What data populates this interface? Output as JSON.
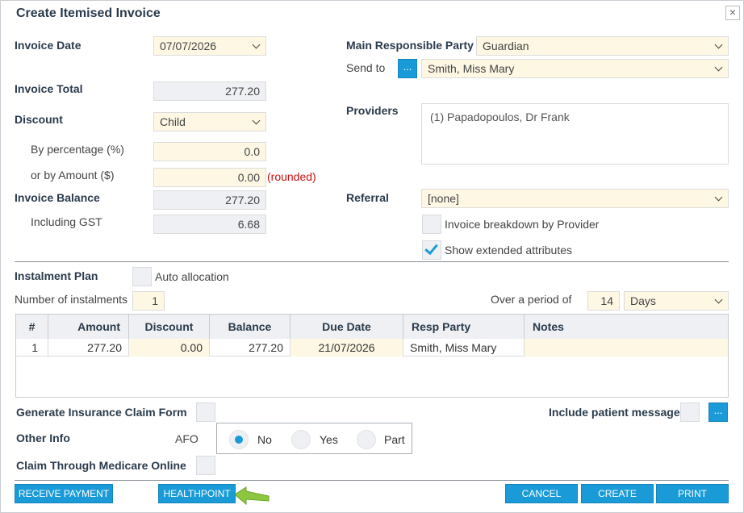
{
  "dialog": {
    "title": "Create Itemised Invoice",
    "close_glyph": "×"
  },
  "left": {
    "invoice_date_label": "Invoice Date",
    "invoice_date_value": "07/07/2026",
    "invoice_total_label": "Invoice Total",
    "invoice_total_value": "277.20",
    "discount_label": "Discount",
    "discount_value": "Child",
    "by_percentage_label": "By percentage (%)",
    "by_percentage_value": "0.0",
    "by_amount_label": "or by Amount ($)",
    "by_amount_value": "0.00",
    "rounded_note": "(rounded)",
    "invoice_balance_label": "Invoice Balance",
    "invoice_balance_value": "277.20",
    "gst_label": "Including GST",
    "gst_value": "6.68"
  },
  "right": {
    "main_party_label": "Main Responsible Party",
    "main_party_value": "Guardian",
    "send_to_label": "Send to",
    "send_to_button": "...",
    "send_to_value": "Smith, Miss Mary",
    "providers_label": "Providers",
    "providers_value": "(1) Papadopoulos, Dr Frank",
    "referral_label": "Referral",
    "referral_value": "[none]",
    "breakdown_label": "Invoice breakdown by Provider",
    "breakdown_checked": false,
    "extended_label": "Show extended attributes",
    "extended_checked": true
  },
  "instalment": {
    "plan_label": "Instalment Plan",
    "auto_allocation_label": "Auto allocation",
    "num_label": "Number of instalments",
    "num_value": "1",
    "period_label": "Over a period of",
    "period_value": "14",
    "period_unit": "Days"
  },
  "table": {
    "columns": [
      "#",
      "Amount",
      "Discount",
      "Balance",
      "Due Date",
      "Resp Party",
      "Notes"
    ],
    "rows": [
      {
        "num": "1",
        "amount": "277.20",
        "discount": "0.00",
        "balance": "277.20",
        "due_date": "21/07/2026",
        "resp_party": "Smith, Miss Mary",
        "notes": ""
      }
    ]
  },
  "bottom": {
    "claim_form_label": "Generate Insurance Claim Form",
    "patient_message_label": "Include patient message",
    "patient_message_button": "...",
    "other_info_label": "Other Info",
    "afo_label": "AFO",
    "afo_options": [
      "No",
      "Yes",
      "Part"
    ],
    "afo_selected": "No",
    "medicare_label": "Claim Through Medicare Online"
  },
  "buttons": {
    "receive_payment": "Receive Payment",
    "healthpoint": "Healthpoint",
    "cancel": "Cancel",
    "create": "Create",
    "print": "Print"
  },
  "colors": {
    "accent": "#1a9bd7",
    "highlight_arrow": "#8dc63f",
    "field_yellow": "#fdf7e3",
    "field_grey": "#eef0f3",
    "alert_red": "#cc1111"
  }
}
